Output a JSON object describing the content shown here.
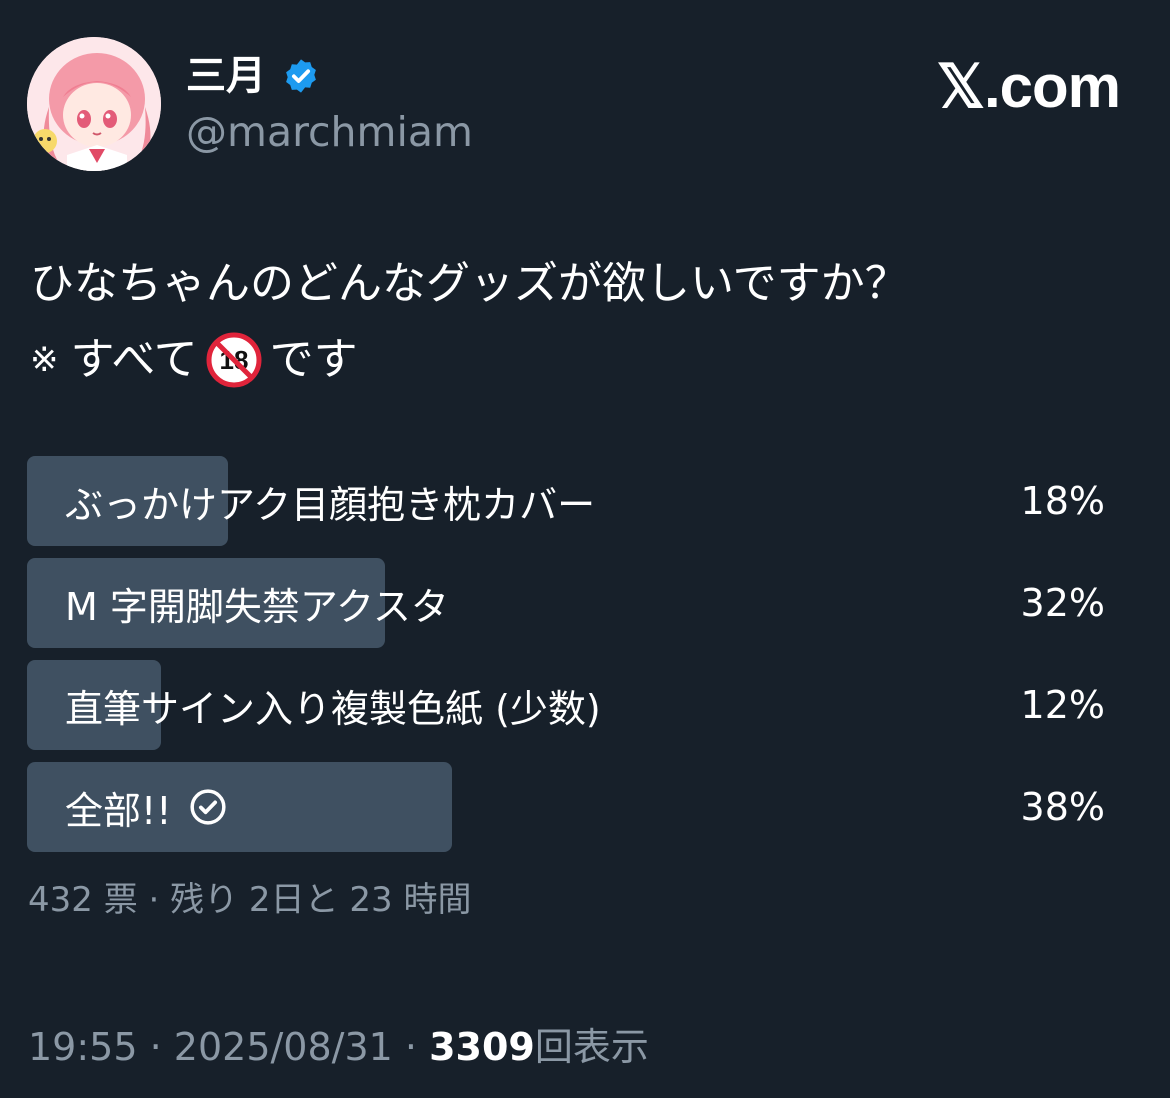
{
  "author": {
    "display_name": "三月",
    "handle": "@marchmiam",
    "verified_icon": "verified-badge-icon"
  },
  "brand": {
    "label": "𝕏.com"
  },
  "post": {
    "line1": "ひなちゃんのどんなグッズが欲しいですか？",
    "line2_mark": "※",
    "line2_before": "すべて",
    "line2_emoji": "no-under-18-icon",
    "line2_after": "です"
  },
  "poll": {
    "options": [
      {
        "label": "ぶっかけアク目顔抱き枕カバー",
        "percent": 18,
        "percent_label": "18%",
        "selected": false
      },
      {
        "label": "M 字開脚失禁アクスタ",
        "percent": 32,
        "percent_label": "32%",
        "selected": false
      },
      {
        "label": "直筆サイン入り複製色紙 (少数)",
        "percent": 12,
        "percent_label": "12%",
        "selected": false
      },
      {
        "label": "全部!!",
        "percent": 38,
        "percent_label": "38%",
        "selected": true
      }
    ],
    "meta": "432 票 · 残り 2日と 23 時間"
  },
  "tweet_meta": {
    "time": "19:55",
    "sep1": "·",
    "date": "2025/08/31",
    "sep2": "·",
    "views_count": "3309",
    "views_label": "回表示"
  },
  "colors": {
    "background": "#17202a",
    "poll_fill": "#3f5061",
    "muted": "#8b98a5",
    "verified": "#1d9bf0"
  }
}
